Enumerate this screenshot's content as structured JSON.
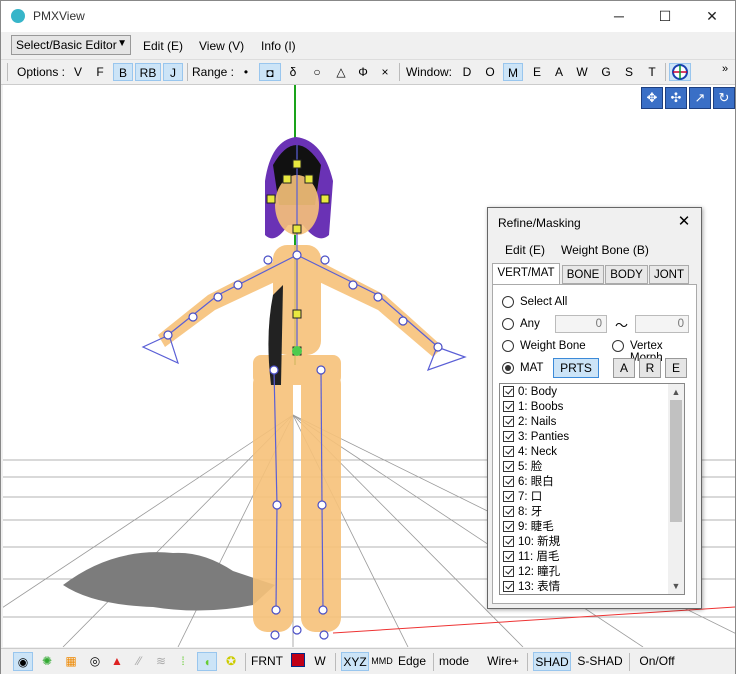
{
  "window": {
    "title": "PMXView",
    "min": "─",
    "max": "☐",
    "close": "✕"
  },
  "menubar": {
    "mode_select": "Select/Basic Editor",
    "items": [
      "Edit (E)",
      "View (V)",
      "Info (I)"
    ]
  },
  "toolbar": {
    "options_label": "Options :",
    "options": [
      "V",
      "F",
      "B",
      "RB",
      "J"
    ],
    "range_label": "Range :",
    "range": [
      "•",
      "◘",
      "δ",
      "○",
      "△",
      "Φ",
      "×"
    ],
    "window_label": "Window:",
    "windows": [
      "D",
      "O",
      "M",
      "E",
      "A",
      "W",
      "G",
      "S",
      "T"
    ],
    "overflow": "»"
  },
  "statusbar": {
    "frnt": "FRNT",
    "w": "W",
    "xyz": "XYZ",
    "edge": "Edge",
    "mode": "mode",
    "wire": "Wire+",
    "shad": "SHAD",
    "s_shad": "S-SHAD",
    "onoff": "On/Off"
  },
  "dialog": {
    "title": "Refine/Masking",
    "menu": [
      "Edit (E)",
      "Weight Bone (B)"
    ],
    "tabs": [
      "VERT/MAT",
      "BONE",
      "BODY",
      "JONT"
    ],
    "select_all": "Select All",
    "any": "Any",
    "any_from": "0",
    "tilde": "〜",
    "any_to": "0",
    "weight_bone": "Weight Bone",
    "vertex_morph": "Vertex Morph",
    "mat": "MAT",
    "prts": "PRTS",
    "a": "A",
    "r": "R",
    "e": "E",
    "materials": [
      "0: Body",
      "1: Boobs",
      "2: Nails",
      "3: Panties",
      "4: Neck",
      "5: 脸",
      "6: 眼白",
      "7: 口",
      "8: 牙",
      "9: 睫毛",
      "10: 新規",
      "11: 眉毛",
      "12: 瞳孔",
      "13: 表情"
    ]
  },
  "colors": {
    "accent": "#cce4f7",
    "figure": "#f7c27a",
    "bone": "#5a5fd6",
    "hair": "#7a3fc0"
  }
}
